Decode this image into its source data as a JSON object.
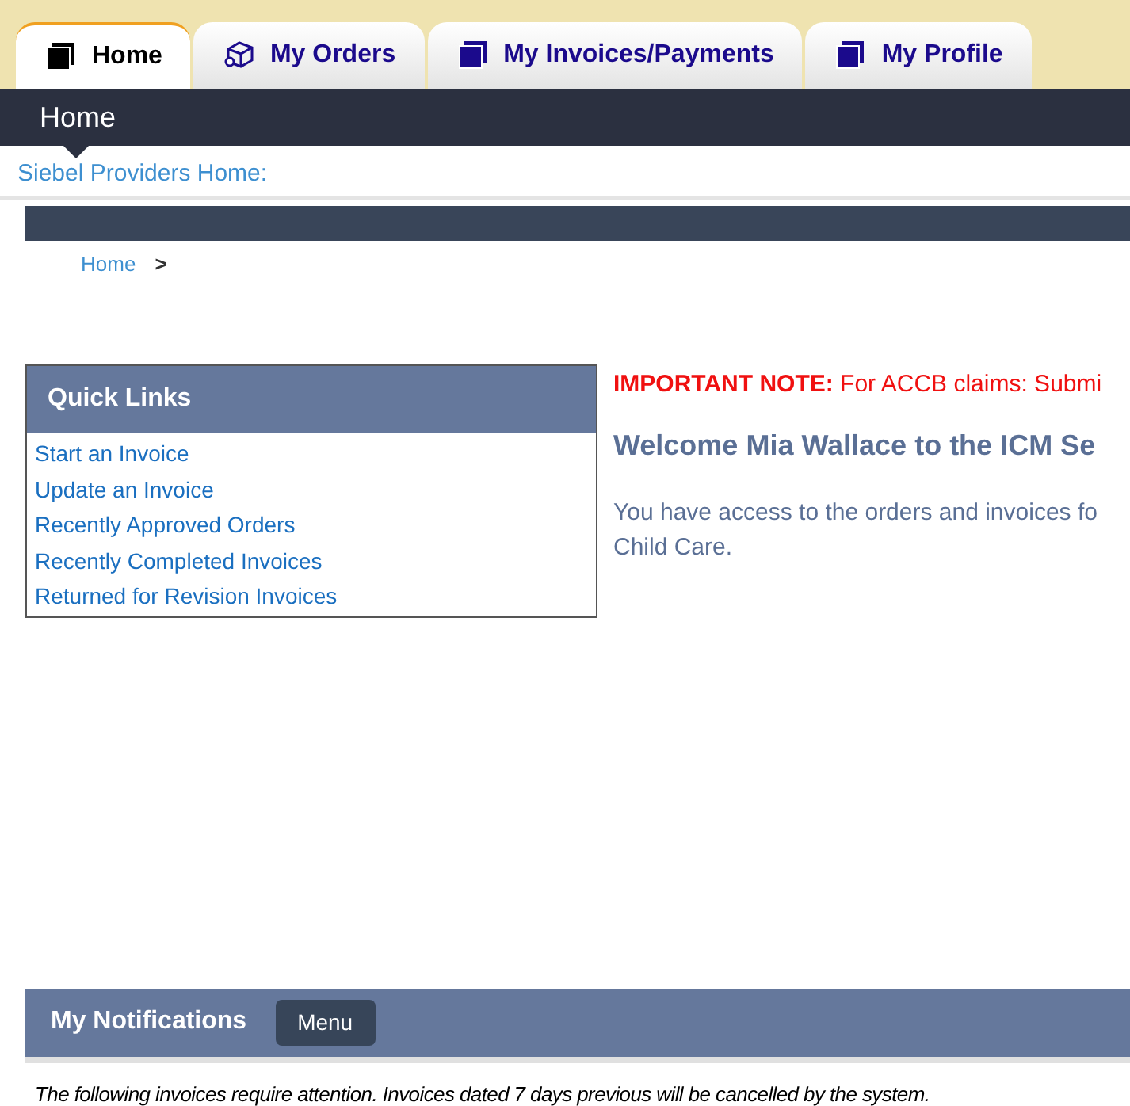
{
  "tabs": [
    {
      "label": "Home",
      "kind": "page",
      "selected": true
    },
    {
      "label": "My Orders",
      "kind": "orders",
      "selected": false
    },
    {
      "label": "My Invoices/Payments",
      "kind": "page",
      "selected": false
    },
    {
      "label": "My Profile",
      "kind": "page",
      "selected": false
    }
  ],
  "page_bar": {
    "title": "Home"
  },
  "subtitle": "Siebel Providers Home:",
  "breadcrumb": {
    "link": "Home",
    "separator": ">"
  },
  "quick_links": {
    "title": "Quick Links",
    "items": [
      "Start an Invoice",
      "Update an Invoice",
      "Recently Approved Orders",
      "Recently Completed Invoices",
      "Returned for Revision Invoices"
    ]
  },
  "note": "**IMPORTANT NOTE:** For ACCB claims: Submi",
  "welcome": "Welcome Mia Wallace to the ICM Se",
  "access_text": [
    "You have access to the orders and invoices fo",
    "Child Care."
  ],
  "notifications": {
    "title": "My Notifications",
    "menu": "Menu",
    "message": "The following invoices require attention. Invoices dated 7 days previous will be cancelled by the system."
  }
}
